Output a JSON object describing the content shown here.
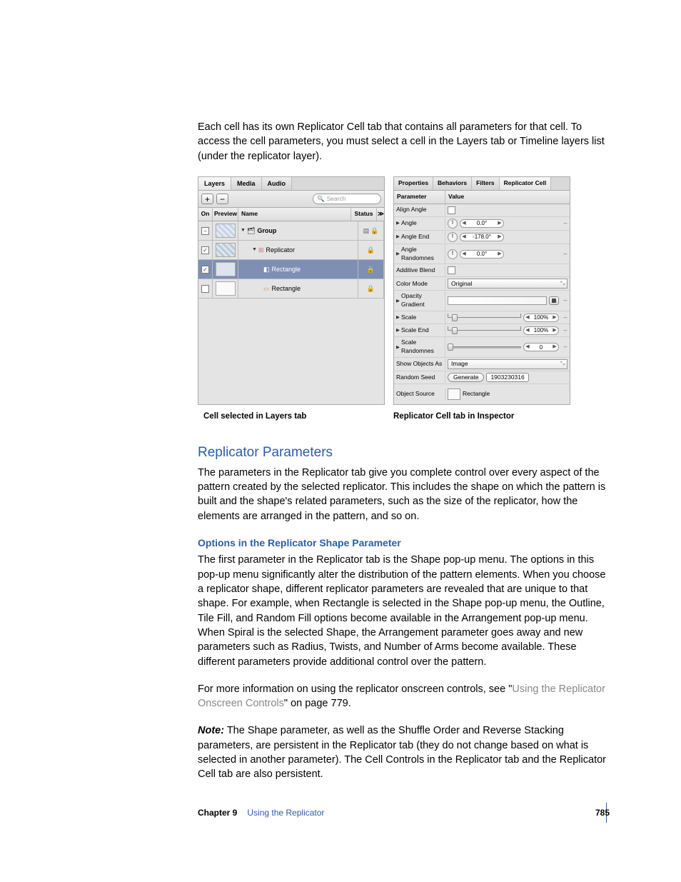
{
  "intro": "Each cell has its own Replicator Cell tab that contains all parameters for that cell. To access the cell parameters, you must select a cell in the Layers tab or Timeline layers list (under the replicator layer).",
  "layers_panel": {
    "tabs": [
      "Layers",
      "Media",
      "Audio"
    ],
    "search_placeholder": "Search",
    "columns": {
      "on": "On",
      "preview": "Preview",
      "name": "Name",
      "status": "Status"
    },
    "rows": [
      {
        "checked": true,
        "dash": false,
        "name": "Group",
        "bold": true,
        "indent": 0,
        "status_icons": "dual",
        "disclose": true,
        "icon": "folder"
      },
      {
        "checked": true,
        "dash": false,
        "name": "Replicator",
        "bold": false,
        "indent": 16,
        "status_icons": "lock",
        "disclose": true,
        "icon": "replicator"
      },
      {
        "checked": true,
        "dash": false,
        "name": "Rectangle",
        "bold": false,
        "indent": 32,
        "status_icons": "lock",
        "disclose": false,
        "icon": "rect",
        "selected": true
      },
      {
        "checked": false,
        "dash": false,
        "name": "Rectangle",
        "bold": false,
        "indent": 32,
        "status_icons": "lock",
        "disclose": false,
        "icon": "rect-outline"
      }
    ]
  },
  "inspector_panel": {
    "tabs": [
      "Properties",
      "Behaviors",
      "Filters",
      "Replicator Cell"
    ],
    "active_tab": 3,
    "columns": {
      "param": "Parameter",
      "value": "Value"
    },
    "rows": {
      "align_angle": {
        "label": "Align Angle"
      },
      "angle": {
        "label": "Angle",
        "value": "0.0°"
      },
      "angle_end": {
        "label": "Angle End",
        "value": "-178.0°"
      },
      "angle_randomness": {
        "label": "Angle Randomnes",
        "value": "0.0°"
      },
      "additive_blend": {
        "label": "Additive Blend"
      },
      "color_mode": {
        "label": "Color Mode",
        "value": "Original"
      },
      "opacity_gradient": {
        "label": "Opacity Gradient"
      },
      "scale": {
        "label": "Scale",
        "value": "100%"
      },
      "scale_end": {
        "label": "Scale End",
        "value": "100%"
      },
      "scale_randomness": {
        "label": "Scale Randomnes",
        "value": "0"
      },
      "show_objects_as": {
        "label": "Show Objects As",
        "value": "Image"
      },
      "random_seed": {
        "label": "Random Seed",
        "button": "Generate",
        "value": "1903230316"
      },
      "object_source": {
        "label": "Object Source",
        "value": "Rectangle"
      }
    }
  },
  "captions": {
    "left": "Cell selected in Layers tab",
    "right": "Replicator Cell tab in Inspector"
  },
  "section": {
    "title": "Replicator Parameters",
    "para1": "The parameters in the Replicator tab give you complete control over every aspect of the pattern created by the selected replicator. This includes the shape on which the pattern is built and the shape's related parameters, such as the size of the replicator, how the elements are arranged in the pattern, and so on.",
    "subtitle": "Options in the Replicator Shape Parameter",
    "para2": "The first parameter in the Replicator tab is the Shape pop-up menu. The options in this pop-up menu significantly alter the distribution of the pattern elements. When you choose a replicator shape, different replicator parameters are revealed that are unique to that shape. For example, when Rectangle is selected in the Shape pop-up menu, the Outline, Tile Fill, and Random Fill options become available in the Arrangement pop-up menu. When Spiral is the selected Shape, the Arrangement parameter goes away and new parameters such as Radius, Twists, and Number of Arms become available. These different parameters provide additional control over the pattern.",
    "para3a": "For more information on using the replicator onscreen controls, see \"",
    "link": "Using the Replicator Onscreen Controls",
    "para3b": "\" on page 779.",
    "note_label": "Note:",
    "note_body": "  The Shape parameter, as well as the Shuffle Order and Reverse Stacking parameters, are persistent in the Replicator tab (they do not change based on what is selected in another parameter). The Cell Controls in the Replicator tab and the Replicator Cell tab are also persistent."
  },
  "footer": {
    "chapter": "Chapter 9",
    "title": "Using the Replicator",
    "page": "785"
  }
}
